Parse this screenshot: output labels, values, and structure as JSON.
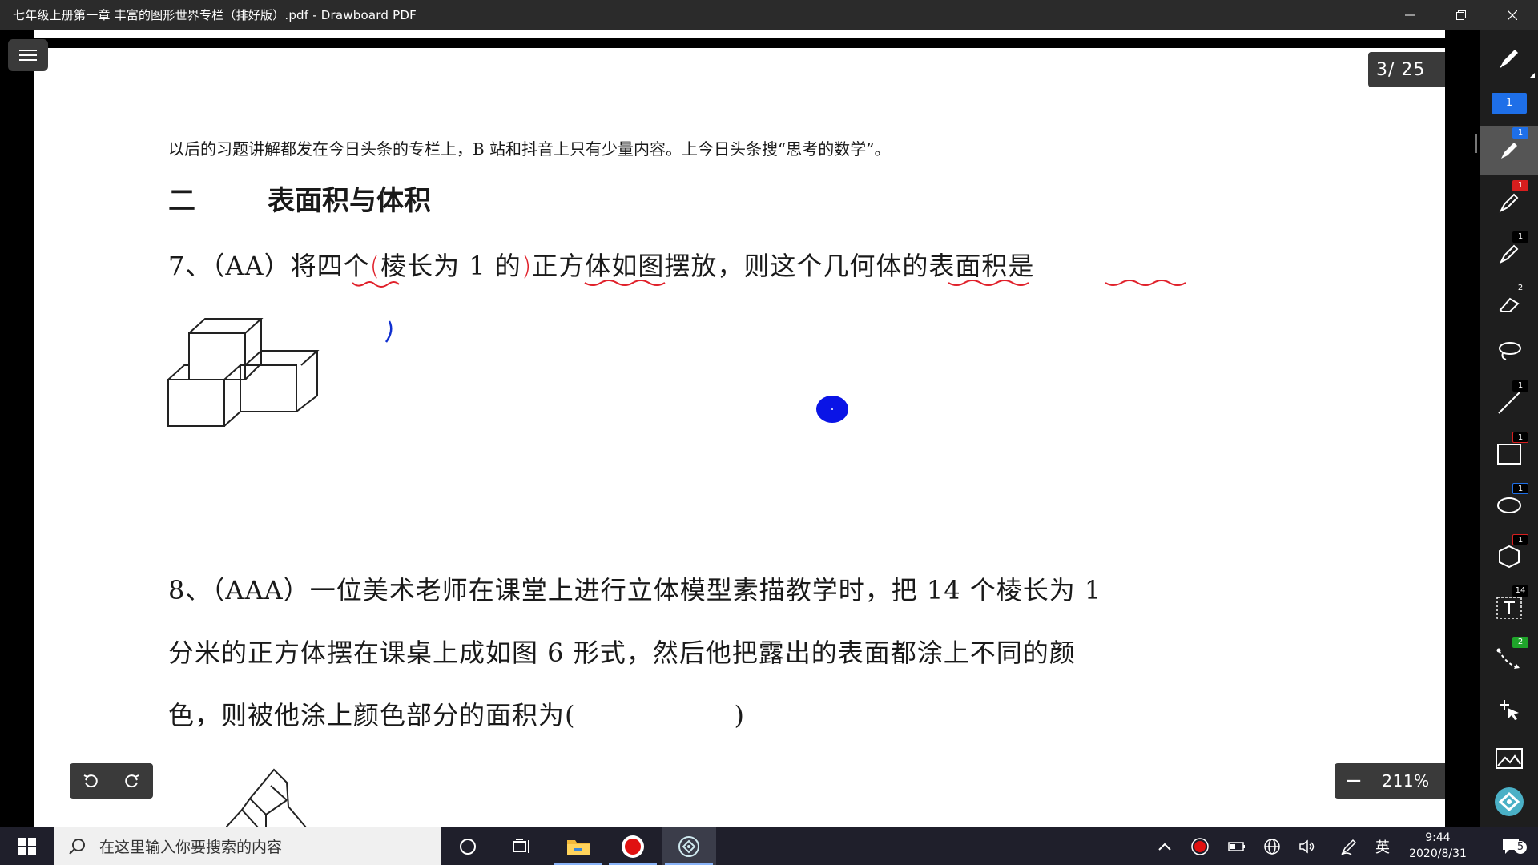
{
  "window": {
    "title": "七年级上册第一章 丰富的图形世界专栏（排好版）.pdf - Drawboard PDF",
    "minimize_icon": "minimize-icon",
    "restore_icon": "restore-icon",
    "close_icon": "close-icon"
  },
  "document": {
    "intro": "以后的习题讲解都发在今日头条的专栏上，B 站和抖音上只有少量内容。上今日头条搜“思考的数学”。",
    "section_number": "二",
    "section_title": "表面积与体积",
    "q7": {
      "parts": [
        "7、（AA）将",
        "四个",
        "(",
        "棱长为 1 的",
        ")",
        "正方体",
        "如图摆放，则这个",
        "几何体",
        "的",
        "表面积",
        "是"
      ]
    },
    "q8": {
      "line1": "8、（AAA）一位美术老师在课堂上进行立体模型素描教学时，把 14 个棱长为 1",
      "line2": "分米的正方体摆在课桌上成如图 6 形式，然后他把露出的表面都涂上不同的颜",
      "line3": "色，则被他涂上颜色部分的面积为(　　　　　　)"
    }
  },
  "overlay": {
    "page_counter": "3/ 25",
    "zoom_level": "211%",
    "zoom_out_label": "−",
    "zoom_in_label": "+"
  },
  "colors": {
    "pen_red": "#e0202a",
    "pen_blue": "#1030d0",
    "cursor_dot": "#0a14e6",
    "badge_blue": "#1e6fe8",
    "badge_red": "#d81e1e",
    "badge_green": "#1fa52a",
    "badge_black": "#000000"
  },
  "toolbar": {
    "tools": [
      {
        "name": "pen-tool-icon",
        "badge": ""
      },
      {
        "name": "color-swatch",
        "badge": "1"
      },
      {
        "name": "pen-1-icon",
        "badge": "1"
      },
      {
        "name": "pen-2-icon",
        "badge": "1"
      },
      {
        "name": "pen-3-icon",
        "badge": "1"
      },
      {
        "name": "eraser-icon",
        "badge": "2"
      },
      {
        "name": "lasso-icon",
        "badge": ""
      },
      {
        "name": "line-icon",
        "badge": "1"
      },
      {
        "name": "rectangle-icon",
        "badge": "1"
      },
      {
        "name": "ellipse-icon",
        "badge": "1"
      },
      {
        "name": "polygon-icon",
        "badge": "1"
      },
      {
        "name": "text-icon",
        "badge": "14"
      },
      {
        "name": "connector-icon",
        "badge": "2"
      },
      {
        "name": "move-icon",
        "badge": ""
      },
      {
        "name": "image-icon",
        "badge": ""
      },
      {
        "name": "app-logo-icon",
        "badge": ""
      }
    ]
  },
  "taskbar": {
    "search_placeholder": "在这里输入你要搜索的内容",
    "ime": "英",
    "time": "9:44",
    "date": "2020/8/31",
    "notification_count": "5"
  }
}
